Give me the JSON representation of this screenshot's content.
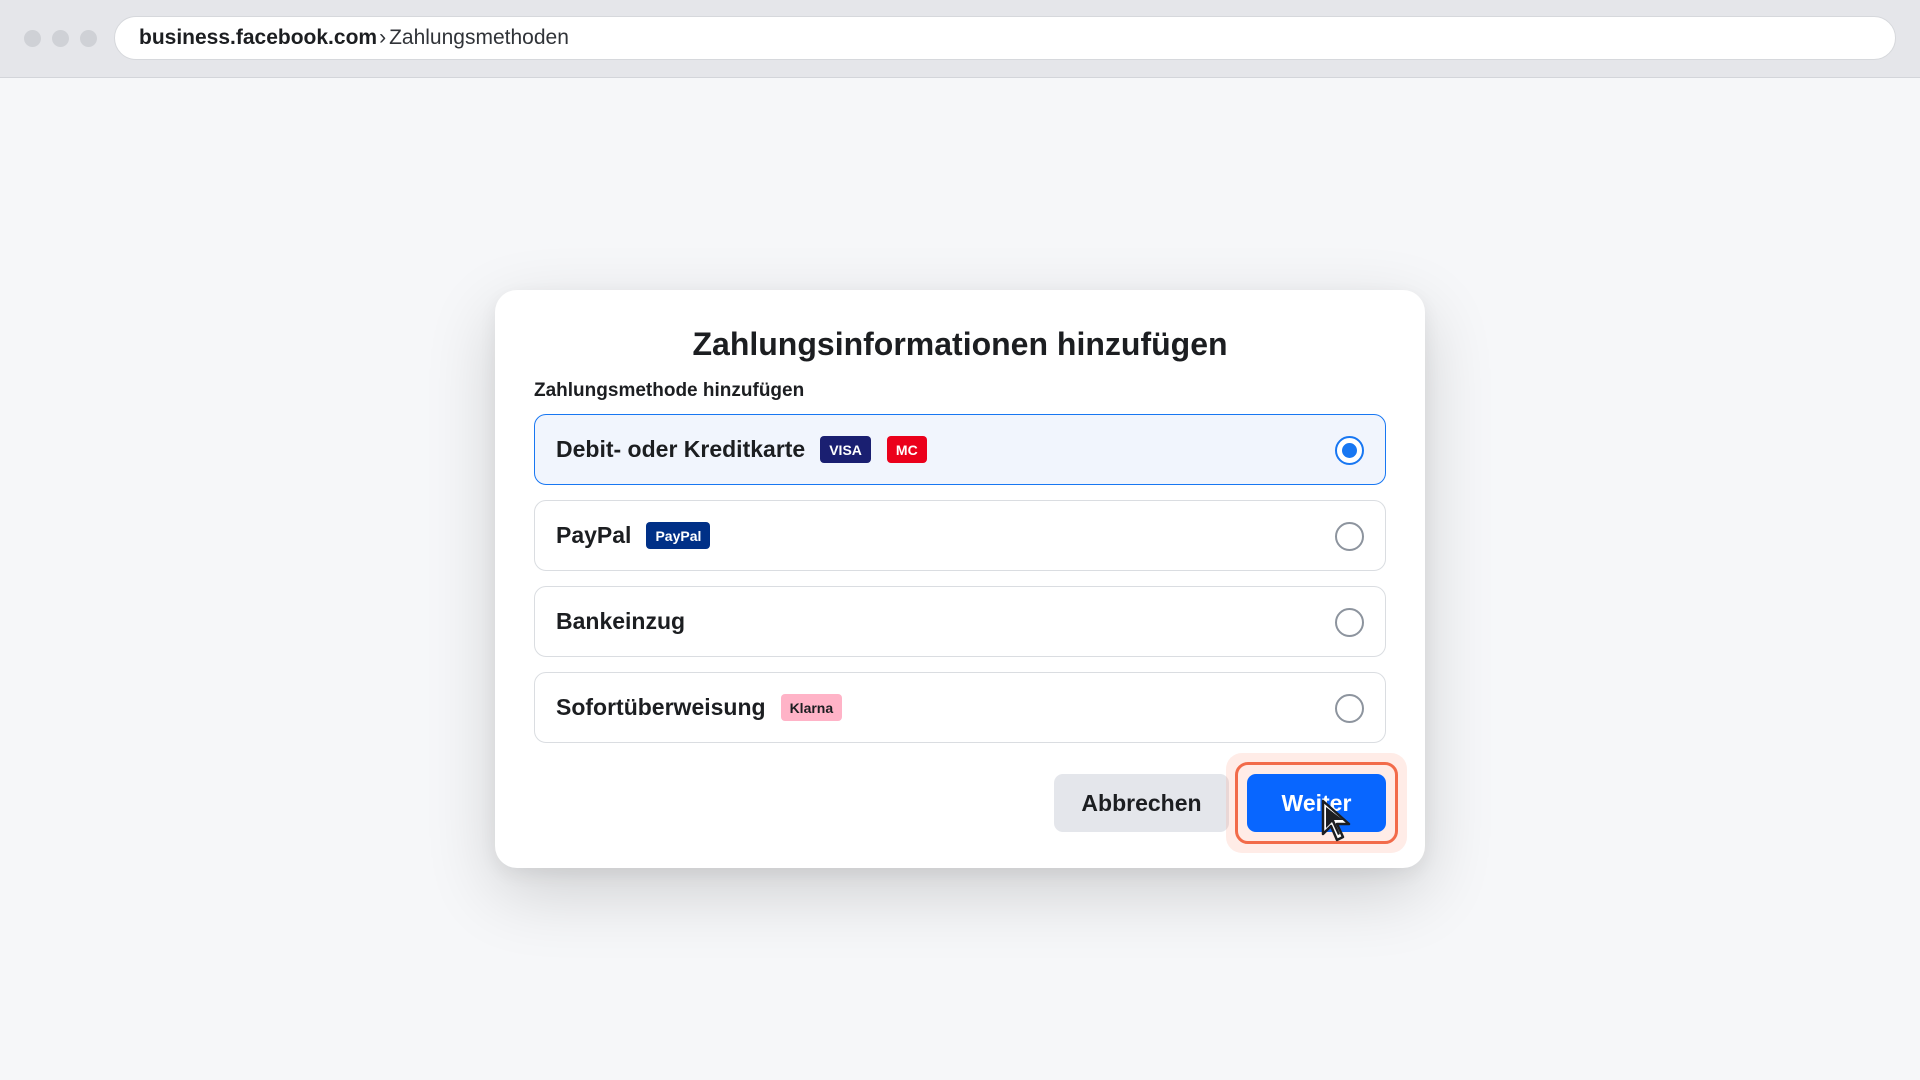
{
  "browser": {
    "url_host": "business.facebook.com",
    "url_separator": "›",
    "url_path": "Zahlungsmethoden"
  },
  "dialog": {
    "title": "Zahlungsinformationen hinzufügen",
    "section_label": "Zahlungsmethode hinzufügen",
    "options": [
      {
        "label": "Debit- oder Kreditkarte",
        "badges": [
          "VISA",
          "MC"
        ],
        "selected": true
      },
      {
        "label": "PayPal",
        "badges": [
          "PayPal"
        ],
        "selected": false
      },
      {
        "label": "Bankeinzug",
        "badges": [],
        "selected": false
      },
      {
        "label": "Sofortüberweisung",
        "badges": [
          "Klarna"
        ],
        "selected": false
      }
    ],
    "buttons": {
      "cancel_label": "Abbrechen",
      "next_label": "Weiter"
    }
  },
  "colors": {
    "accent": "#1877f2",
    "primary_button": "#0866ff",
    "highlight": "#f26b4a",
    "visa": "#1a1f71",
    "mastercard": "#eb001b",
    "paypal": "#003087",
    "klarna": "#ffb3c7"
  },
  "icons": {
    "cursor": "mouse-pointer-icon"
  }
}
